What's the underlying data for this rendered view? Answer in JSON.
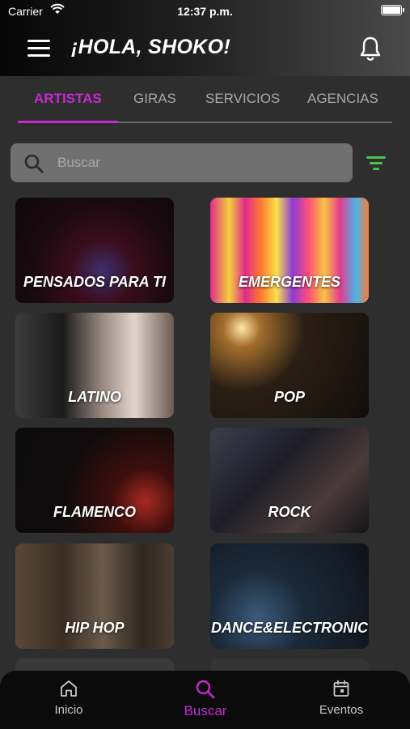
{
  "status_bar": {
    "carrier": "Carrier",
    "time": "12:37 p.m."
  },
  "header": {
    "greeting": "¡HOLA, SHOKO!"
  },
  "tabs": [
    {
      "label": "ARTISTAS",
      "active": true
    },
    {
      "label": "GIRAS",
      "active": false
    },
    {
      "label": "SERVICIOS",
      "active": false
    },
    {
      "label": "AGENCIAS",
      "active": false
    }
  ],
  "search": {
    "placeholder": "Buscar"
  },
  "categories": [
    {
      "label": "PENSADOS PARA TI"
    },
    {
      "label": "EMERGENTES"
    },
    {
      "label": "LATINO"
    },
    {
      "label": "POP"
    },
    {
      "label": "FLAMENCO"
    },
    {
      "label": "ROCK"
    },
    {
      "label": "HIP HOP"
    },
    {
      "label": "DANCE&ELECTRONIC"
    }
  ],
  "bottom_nav": [
    {
      "label": "Inicio",
      "icon": "home-icon",
      "active": false
    },
    {
      "label": "Buscar",
      "icon": "search-icon",
      "active": true
    },
    {
      "label": "Eventos",
      "icon": "calendar-icon",
      "active": false
    }
  ],
  "colors": {
    "accent": "#c62ad0",
    "filter": "#4bc24f",
    "background": "#2e2e2e"
  }
}
